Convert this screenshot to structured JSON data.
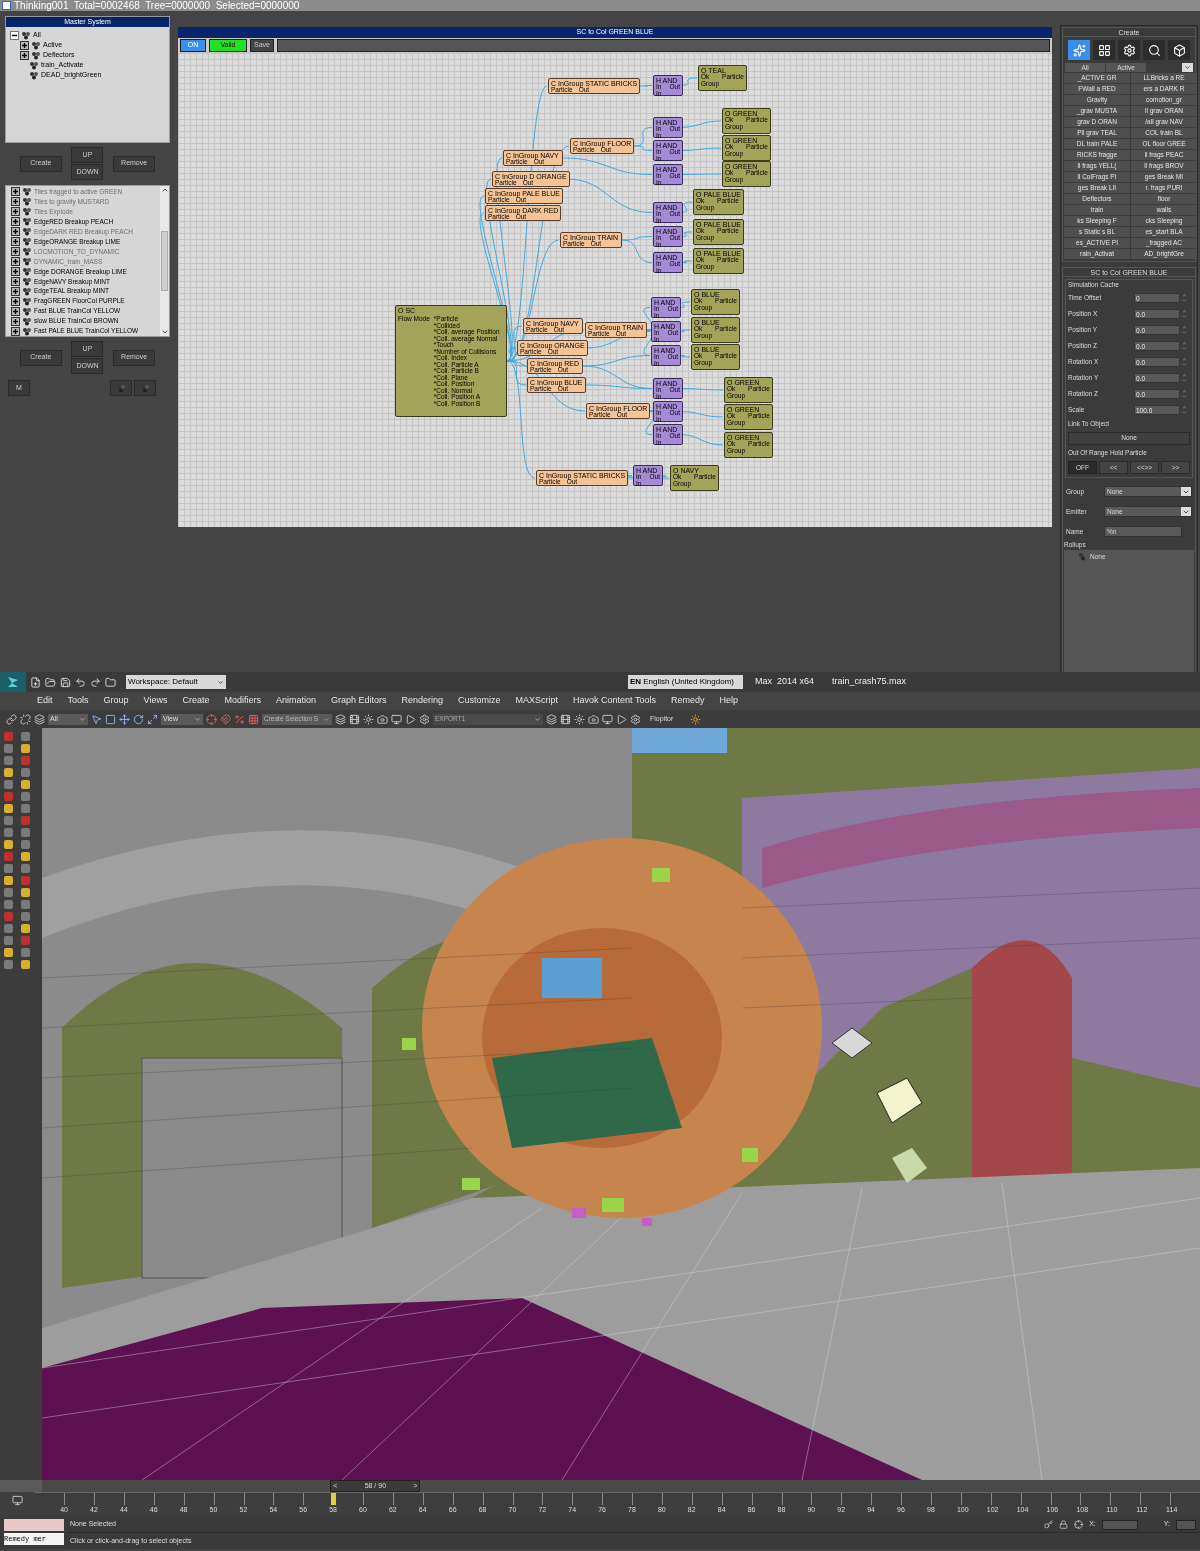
{
  "title_bar": "Thinking001  Total=0002468  Tree=0000000  Selected=0000000",
  "master_system": {
    "title": "Master System",
    "tree": [
      {
        "label": "All",
        "kind": "folder",
        "expanded": true,
        "children": [
          {
            "label": "Active",
            "kind": "folder",
            "expanded": false
          },
          {
            "label": "Deflectors",
            "kind": "folder",
            "expanded": false
          },
          {
            "label": "train_Activate",
            "kind": "leaf"
          },
          {
            "label": "DEAD_brightGreen",
            "kind": "leaf"
          }
        ]
      }
    ],
    "buttons": {
      "create": "Create",
      "up": "UP",
      "down": "DOWN",
      "remove": "Remove"
    }
  },
  "events": {
    "items": [
      {
        "label": "Tiles fragged to active GREEN",
        "disabled": true
      },
      {
        "label": "Tiles to gravity MUSTARD",
        "disabled": true
      },
      {
        "label": "Tiles Explode",
        "disabled": true
      },
      {
        "label": "EdgeRED Breakup PEACH",
        "disabled": false
      },
      {
        "label": "EdgeDARK RED Breakup PEACH",
        "disabled": true
      },
      {
        "label": "EdgeORANGE Breakup LIME",
        "disabled": false
      },
      {
        "label": "LOCMOTION_TO_DYNAMIC",
        "disabled": true
      },
      {
        "label": "DYNAMIC_train_MASS",
        "disabled": true
      },
      {
        "label": "Edge DORANGE Breakup LIME",
        "disabled": false
      },
      {
        "label": "EdgeNAVY Breakup MINT",
        "disabled": false
      },
      {
        "label": "EdgeTEAL Breakup MINT",
        "disabled": false
      },
      {
        "label": "FragGREEN FloorCol PURPLE",
        "disabled": false
      },
      {
        "label": "Fast BLUE TrainCol YELLOW",
        "disabled": false
      },
      {
        "label": "slow BLUE TrainCol BROWN",
        "disabled": false
      },
      {
        "label": "Fast PALE BLUE TrainCol YELLOW",
        "disabled": false
      }
    ],
    "buttons": {
      "create": "Create",
      "up": "UP",
      "down": "DOWN",
      "remove": "Remove",
      "m": "M"
    }
  },
  "graph": {
    "title": "SC to Col GREEN BLUE",
    "on_button": {
      "label": "ON",
      "on": true
    },
    "valid_button": {
      "label": "Valid",
      "valid": true
    },
    "save_button": "Save",
    "nodes": [
      {
        "kind": "system",
        "title": "O SC",
        "mode": "Flow Mode",
        "fields": [
          "*Particle",
          "*Collided",
          "*Coll. average Position",
          "*Coll. average Normal",
          "*Touch",
          "*Number of Collisions",
          "*Coll. Index",
          "*Coll. Particle A",
          "*Coll. Particle B",
          "*Coll. Plane",
          "*Coll. Position",
          "*Coll. Normal",
          "*Coll. Position A",
          "*Coll. Position B"
        ]
      },
      {
        "kind": "condition",
        "title": "C InGroup STATIC BRICKS",
        "fields": [
          "Particle",
          "Out"
        ]
      },
      {
        "kind": "condition",
        "title": "C InGroup FLOOR",
        "fields": [
          "Particle",
          "Out"
        ]
      },
      {
        "kind": "condition",
        "title": "C InGroup NAVY",
        "fields": [
          "Particle",
          "Out"
        ]
      },
      {
        "kind": "condition",
        "title": "C InGroup D ORANGE",
        "fields": [
          "Particle",
          "Out"
        ]
      },
      {
        "kind": "condition",
        "title": "C InGroup PALE BLUE",
        "fields": [
          "Particle",
          "Out"
        ]
      },
      {
        "kind": "condition",
        "title": "C InGroup DARK RED",
        "fields": [
          "Particle",
          "Out"
        ]
      },
      {
        "kind": "condition",
        "title": "C InGroup TRAIN",
        "fields": [
          "Particle",
          "Out"
        ]
      },
      {
        "kind": "condition",
        "title": "C InGroup NAVY",
        "fields": [
          "Particle",
          "Out"
        ]
      },
      {
        "kind": "condition",
        "title": "C InGroup TRAIN",
        "fields": [
          "Particle",
          "Out"
        ]
      },
      {
        "kind": "condition",
        "title": "C InGroup ORANGE",
        "fields": [
          "Particle",
          "Out"
        ]
      },
      {
        "kind": "condition",
        "title": "C InGroup RED",
        "fields": [
          "Particle",
          "Out"
        ]
      },
      {
        "kind": "condition",
        "title": "C InGroup BLUE",
        "fields": [
          "Particle",
          "Out"
        ]
      },
      {
        "kind": "condition",
        "title": "C InGroup FLOOR",
        "fields": [
          "Particle",
          "Out"
        ]
      },
      {
        "kind": "condition",
        "title": "C InGroup STATIC BRICKS",
        "fields": [
          "Particle",
          "Out"
        ]
      },
      {
        "kind": "and",
        "title": "H AND",
        "fields": [
          "In",
          "Out",
          "In"
        ]
      },
      {
        "kind": "and",
        "title": "H AND",
        "fields": [
          "In",
          "Out",
          "In"
        ]
      },
      {
        "kind": "and",
        "title": "H AND",
        "fields": [
          "In",
          "Out",
          "In"
        ]
      },
      {
        "kind": "and",
        "title": "H AND",
        "fields": [
          "In",
          "Out",
          "In"
        ]
      },
      {
        "kind": "and",
        "title": "H AND",
        "fields": [
          "In",
          "Out",
          "In"
        ]
      },
      {
        "kind": "and",
        "title": "H AND",
        "fields": [
          "In",
          "Out",
          "In"
        ]
      },
      {
        "kind": "and",
        "title": "H AND",
        "fields": [
          "In",
          "Out",
          "In"
        ]
      },
      {
        "kind": "and",
        "title": "H AND",
        "fields": [
          "In",
          "Out",
          "In"
        ]
      },
      {
        "kind": "and",
        "title": "H AND",
        "fields": [
          "In",
          "Out",
          "In"
        ]
      },
      {
        "kind": "and",
        "title": "H AND",
        "fields": [
          "In",
          "Out",
          "In"
        ]
      },
      {
        "kind": "and",
        "title": "H AND",
        "fields": [
          "In",
          "Out",
          "In"
        ]
      },
      {
        "kind": "and",
        "title": "H AND",
        "fields": [
          "In",
          "Out",
          "In"
        ]
      },
      {
        "kind": "and",
        "title": "H AND",
        "fields": [
          "In",
          "Out",
          "In"
        ]
      },
      {
        "kind": "and",
        "title": "H AND",
        "fields": [
          "In",
          "Out",
          "In"
        ]
      },
      {
        "kind": "output",
        "title": "O TEAL",
        "fields": [
          "Ok",
          "Particle",
          "Group"
        ]
      },
      {
        "kind": "output",
        "title": "O GREEN",
        "fields": [
          "Ok",
          "Particle",
          "Group"
        ]
      },
      {
        "kind": "output",
        "title": "O GREEN",
        "fields": [
          "Ok",
          "Particle",
          "Group"
        ]
      },
      {
        "kind": "output",
        "title": "O GREEN",
        "fields": [
          "Ok",
          "Particle",
          "Group"
        ]
      },
      {
        "kind": "output",
        "title": "O PALE BLUE",
        "fields": [
          "Ok",
          "Particle",
          "Group"
        ]
      },
      {
        "kind": "output",
        "title": "O PALE BLUE",
        "fields": [
          "Ok",
          "Particle",
          "Group"
        ]
      },
      {
        "kind": "output",
        "title": "O PALE BLUE",
        "fields": [
          "Ok",
          "Particle",
          "Group"
        ]
      },
      {
        "kind": "output",
        "title": "O BLUE",
        "fields": [
          "Ok",
          "Particle",
          "Group"
        ]
      },
      {
        "kind": "output",
        "title": "O BLUE",
        "fields": [
          "Ok",
          "Particle",
          "Group"
        ]
      },
      {
        "kind": "output",
        "title": "O BLUE",
        "fields": [
          "Ok",
          "Particle",
          "Group"
        ]
      },
      {
        "kind": "output",
        "title": "O GREEN",
        "fields": [
          "Ok",
          "Particle",
          "Group"
        ]
      },
      {
        "kind": "output",
        "title": "O GREEN",
        "fields": [
          "Ok",
          "Particle",
          "Group"
        ]
      },
      {
        "kind": "output",
        "title": "O GREEN",
        "fields": [
          "Ok",
          "Particle",
          "Group"
        ]
      },
      {
        "kind": "output",
        "title": "O NAVY",
        "fields": [
          "Ok",
          "Particle",
          "Group"
        ]
      }
    ]
  },
  "create_panel": {
    "title": "Create",
    "tool_buttons": [
      {
        "kind": "particles",
        "selected": true
      },
      {
        "kind": "grid",
        "selected": false
      },
      {
        "kind": "gear",
        "selected": false
      },
      {
        "kind": "search",
        "selected": false
      },
      {
        "kind": "cube",
        "selected": false
      }
    ],
    "tabs": [
      "All",
      "Active"
    ],
    "groups": [
      [
        "_ACTIVE GR",
        "LLBricks a RE"
      ],
      [
        "FWall a RED",
        "ers a DARK R"
      ],
      [
        "Gravity",
        "comotion_gr"
      ],
      [
        "_grav MUSTA",
        "ll grav ORAN"
      ],
      [
        "grav D ORAN",
        "/all grav NAV"
      ],
      [
        "Pll grav TEAL",
        "COL train BL"
      ],
      [
        "DL train PALE",
        "OL floor GREE"
      ],
      [
        "RICKS fragge",
        "ll frags PEAC"
      ],
      [
        "ll frags YELL(",
        "ll frags BROV"
      ],
      [
        "ll ColFrags PI",
        "ges Break MI"
      ],
      [
        "ges Break LII",
        "r. frags PURI"
      ],
      [
        "Deflectors",
        "floor"
      ],
      [
        "train",
        "walls"
      ],
      [
        "ks Sleeping F",
        "cks Sleeping"
      ],
      [
        "s Static s BL",
        "es_start BLA"
      ],
      [
        "es_ACTIVE PI",
        "_fragged AC"
      ],
      [
        "rain_Activat",
        "AD_brightGre"
      ]
    ]
  },
  "settings_panel": {
    "title": "SC to Col GREEN BLUE",
    "group_title": "Simulation Cache",
    "fields": [
      {
        "label": "Time Offset",
        "value": "0"
      },
      {
        "label": "Position X",
        "value": "0.0"
      },
      {
        "label": "Position Y",
        "value": "0.0"
      },
      {
        "label": "Position Z",
        "value": "0.0"
      },
      {
        "label": "Rotation X",
        "value": "0.0"
      },
      {
        "label": "Rotation Y",
        "value": "0.0"
      },
      {
        "label": "Rotation Z",
        "value": "0.0"
      },
      {
        "label": "Scale",
        "value": "100.0"
      }
    ],
    "link_label": "Link To Object",
    "link_button": "None",
    "range_label": "Out Of Range Hold Particle",
    "range_buttons": [
      {
        "label": "OFF",
        "selected": true
      },
      {
        "label": "<<",
        "selected": false
      },
      {
        "label": "<<>>",
        "selected": false
      },
      {
        "label": ">>",
        "selected": false
      }
    ],
    "group": {
      "label": "Group",
      "value": "None"
    },
    "emitter": {
      "label": "Emitter",
      "value": "None"
    },
    "name": {
      "label": "Name",
      "value": "%n"
    },
    "rollups_label": "Rollups",
    "rollups": [
      "None"
    ]
  },
  "max": {
    "workspace": "Workspace: Default",
    "language": "**EN** English (United Kingdom)",
    "version": "Max  2014 x64",
    "file": "train_crash75.max",
    "menu": [
      "Edit",
      "Tools",
      "Group",
      "Views",
      "Create",
      "Modifiers",
      "Animation",
      "Graph Editors",
      "Rendering",
      "Customize",
      "MAXScript",
      "Havok Content Tools",
      "Remedy",
      "Help"
    ],
    "toolbar": {
      "filter": "All",
      "view": "View",
      "selection_set": "Create Selection S",
      "layer": "EXPORT1",
      "plugin": "Flopitor"
    },
    "time_slider": {
      "label": "58 / 90",
      "level": 0.27,
      "prev": "<",
      "next": ">"
    },
    "ticks": [
      {
        "label": "40",
        "current": false
      },
      {
        "label": "42",
        "current": false
      },
      {
        "label": "44",
        "current": false
      },
      {
        "label": "46",
        "current": false
      },
      {
        "label": "48",
        "current": false
      },
      {
        "label": "50",
        "current": false
      },
      {
        "label": "52",
        "current": false
      },
      {
        "label": "54",
        "current": false
      },
      {
        "label": "56",
        "current": false
      },
      {
        "label": "58",
        "current": true
      },
      {
        "label": "60",
        "current": false
      },
      {
        "label": "62",
        "current": false
      },
      {
        "label": "64",
        "current": false
      },
      {
        "label": "66",
        "current": false
      },
      {
        "label": "68",
        "current": false
      },
      {
        "label": "70",
        "current": false
      },
      {
        "label": "72",
        "current": false
      },
      {
        "label": "74",
        "current": false
      },
      {
        "label": "76",
        "current": false
      },
      {
        "label": "78",
        "current": false
      },
      {
        "label": "80",
        "current": false
      },
      {
        "label": "82",
        "current": false
      },
      {
        "label": "84",
        "current": false
      },
      {
        "label": "86",
        "current": false
      },
      {
        "label": "88",
        "current": false
      },
      {
        "label": "90",
        "current": false
      },
      {
        "label": "92",
        "current": false
      },
      {
        "label": "94",
        "current": false
      },
      {
        "label": "96",
        "current": false
      },
      {
        "label": "98",
        "current": false
      },
      {
        "label": "100",
        "current": false
      },
      {
        "label": "102",
        "current": false
      },
      {
        "label": "104",
        "current": false
      },
      {
        "label": "106",
        "current": false
      },
      {
        "label": "108",
        "current": false
      },
      {
        "label": "110",
        "current": false
      },
      {
        "label": "112",
        "current": false
      },
      {
        "label": "114",
        "current": false
      }
    ],
    "listener": "Remedy mer",
    "status": "None Selected",
    "prompt": "Click or click-and-drag to select objects",
    "x_label": "X:",
    "y_label": "Y:"
  }
}
